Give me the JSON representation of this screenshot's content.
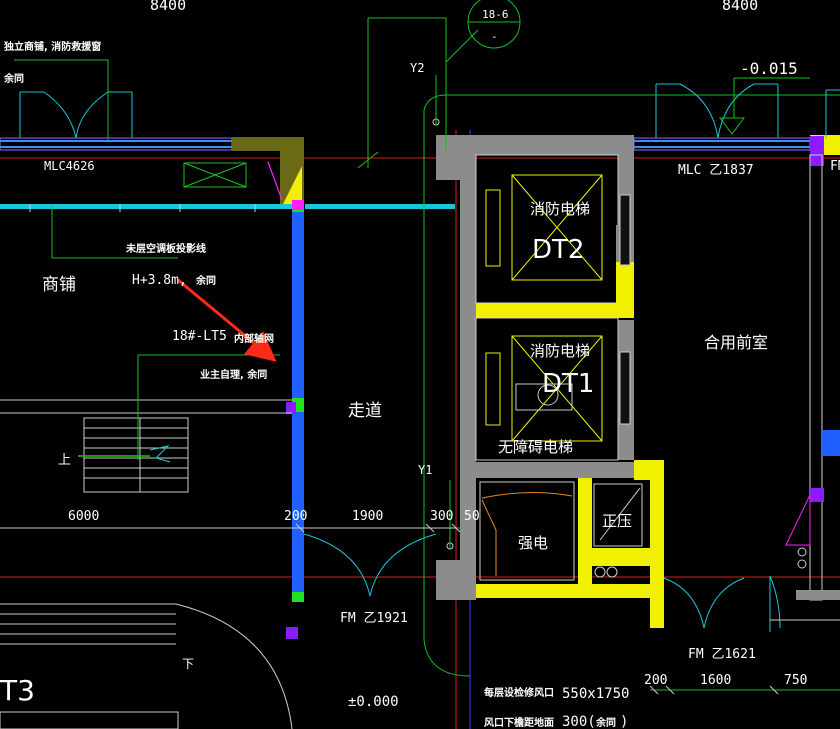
{
  "drawing": {
    "dimensions_top": {
      "left": "8400",
      "right": "8400"
    },
    "grid_bubble": {
      "top": "18-6",
      "bottom": "-"
    },
    "grid_refs": {
      "y2": "Y2",
      "y1": "Y1"
    },
    "level_mark_top": "-0.015",
    "level_mark_bottom": "±0.000",
    "notes": {
      "shop_window": "独立商铺, 消防救援窗",
      "same_left": "余同",
      "same_mid": "余同",
      "same_bottom": "余同",
      "ceiling_line": "未层空调板投影线",
      "height_note": "H+3.8m,",
      "beam_ref": "18#-LT5",
      "inner_ref": "内部轴网",
      "owner_note": "业主自理, 余同",
      "up": "上",
      "down": "下",
      "shaft_row1": "每层设检修风口",
      "shaft_size": "550x1750",
      "shaft_row2": "风口下檐距地面",
      "shaft_height": "300(",
      "shaft_close": ")"
    },
    "rooms": {
      "shop": "商铺",
      "corridor": "走道",
      "elevator2_title": "消防电梯",
      "elevator2_id": "DT2",
      "elevator1_title": "消防电梯",
      "elevator1_id": "DT1",
      "accessible_elevator": "无障碍电梯",
      "strong_power": "强电",
      "pressurization": "正压",
      "shared_lobby": "合用前室",
      "stair_id": "T3"
    },
    "openings": {
      "window_left": "MLC4626",
      "window_right": "MLC 乙1837",
      "door_left": "FM 乙1921",
      "door_right": "FM 乙1621",
      "door_right_cut": "FM"
    },
    "dim_row_left": [
      "6000",
      "200",
      "1900",
      "300",
      "50"
    ],
    "dim_row_right": [
      "200",
      "1600",
      "750"
    ]
  }
}
